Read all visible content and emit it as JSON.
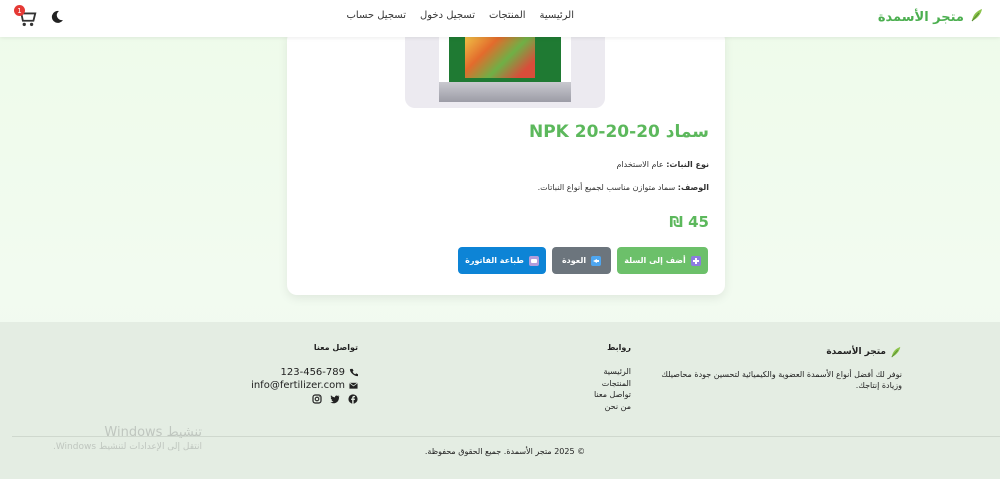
{
  "navbar": {
    "brand": "متجر الأسمدة",
    "links": [
      "الرئيسية",
      "المنتجات",
      "تسجيل دخول",
      "تسجيل حساب"
    ],
    "cart_count": "1"
  },
  "product": {
    "title": "سماد NPK 20-20-20",
    "plant_type_label": "نوع النبات:",
    "plant_type_value": "عام الاستخدام",
    "description_label": "الوصف:",
    "description_value": "سماد متوازن مناسب لجميع أنواع النباتات.",
    "price": "45 ₪",
    "buttons": {
      "add_to_cart": "أضف إلى السلة",
      "back": "العودة",
      "print_invoice": "طباعة الفاتورة"
    }
  },
  "footer": {
    "about_title": "متجر الأسمدة",
    "about_text": "نوفر لك أفضل أنواع الأسمدة العضوية والكيميائية لتحسين جودة محاصيلك وزيادة إنتاجك.",
    "links_title": "روابط",
    "links": [
      "الرئيسية",
      "المنتجات",
      "تواصل معنا",
      "من نحن"
    ],
    "contact_title": "تواصل معنا",
    "phone": "123-456-789",
    "email": "info@fertilizer.com",
    "socials": [
      "facebook-icon",
      "twitter-icon",
      "instagram-icon"
    ],
    "copyright": "© 2025 متجر الأسمدة. جميع الحقوق محفوظة."
  },
  "watermark": {
    "line1": "تنشيط Windows",
    "line2": "انتقل إلى الإعدادات لتنشيط Windows."
  },
  "colors": {
    "accent": "#5cb85c",
    "add_button": "#6cc06a",
    "back_button": "#6c757d",
    "print_button": "#0d84d6",
    "badge": "#e53935"
  }
}
